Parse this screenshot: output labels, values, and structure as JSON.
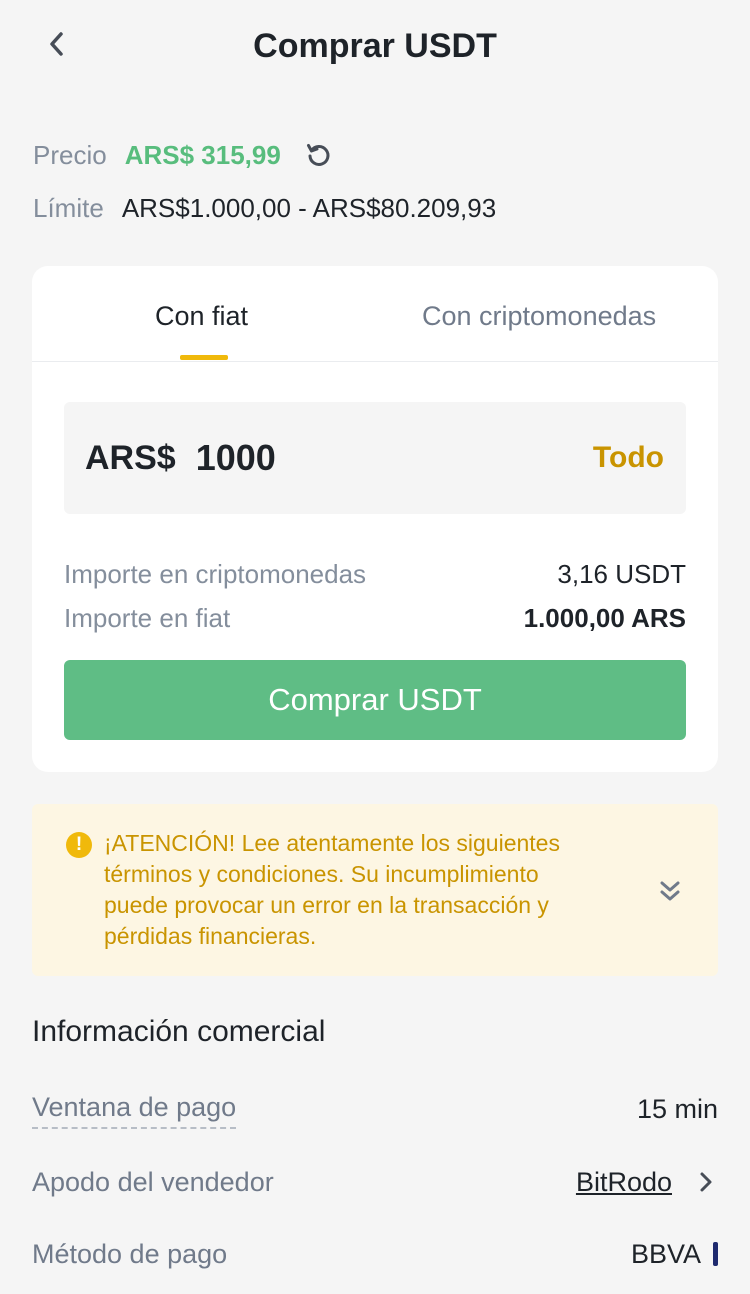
{
  "header": {
    "title": "Comprar USDT",
    "back_icon": "chevron-left-icon"
  },
  "price": {
    "label": "Precio",
    "value": "ARS$ 315,99",
    "refresh_icon": "refresh-icon"
  },
  "limit": {
    "label": "Límite",
    "value": "ARS$1.000,00 - ARS$80.209,93"
  },
  "tabs": [
    {
      "label": "Con fiat",
      "active": true
    },
    {
      "label": "Con criptomonedas",
      "active": false
    }
  ],
  "amount": {
    "currency": "ARS$",
    "value": "1000",
    "all_label": "Todo"
  },
  "summary": {
    "crypto_label": "Importe en criptomonedas",
    "crypto_value": "3,16 USDT",
    "fiat_label": "Importe en fiat",
    "fiat_value": "1.000,00 ARS"
  },
  "buy_button": {
    "label": "Comprar USDT"
  },
  "warning": {
    "text": "¡ATENCIÓN! Lee atentamente los siguientes términos y condiciones. Su incumplimiento puede provocar un error en la transacción y pérdidas financieras.",
    "icon": "alert-icon",
    "expand_icon": "double-chevron-down-icon"
  },
  "commercial": {
    "title": "Información comercial",
    "payment_window_label": "Ventana de pago",
    "payment_window_value": "15 min",
    "seller_label": "Apodo del vendedor",
    "seller_value": "BitRodo",
    "method_label": "Método de pago",
    "method_value": "BBVA"
  },
  "colors": {
    "accent_green": "#58bd7d",
    "button_green": "#5fbd85",
    "accent_yellow": "#f0b90b",
    "warning_text": "#c99400",
    "warning_bg": "#fdf6e3"
  }
}
